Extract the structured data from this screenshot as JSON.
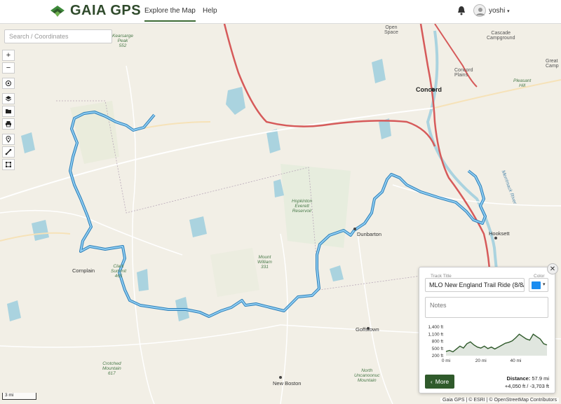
{
  "brand": {
    "name": "GAIA GPS"
  },
  "nav": {
    "explore": "Explore the Map",
    "help": "Help"
  },
  "user": {
    "name": "yoshi"
  },
  "search": {
    "placeholder": "Search / Coordinates"
  },
  "tools": [
    "zoom-in",
    "zoom-out",
    "locate",
    "layers",
    "folder",
    "print",
    "marker",
    "ruler",
    "area"
  ],
  "map_labels": {
    "concord": "Concord",
    "dunbarton": "Dunbarton",
    "goffstown": "Goffstown",
    "hooksett": "Hooksett",
    "new_boston": "New Boston",
    "cornplain": "Cornplain",
    "hopkinton": "Hopkinton\nEverett\nReservoir",
    "cascade": "Cascade\nCampground",
    "great": "Great\nCamp",
    "concord_plains": "Concord\nPlains",
    "pleasant_hill": "Pleasant\nHill",
    "clark_summit": "Clark\nSummit\n465",
    "mount_william": "Mount\nWilliam\n331",
    "crotched": "Crotched\nMountain\n617",
    "north_unc": "North\nUncanoonuc\nMountain",
    "peak_352": "Kearsarge\nPeak\n552",
    "open_space": "Open\nSpace",
    "river": "Merrimack River"
  },
  "panel": {
    "track_title_label": "Track Title",
    "track_title": "MLO New England Trail Ride (8/8/2",
    "color_label": "Color",
    "color": "#1a8cf0",
    "notes_placeholder": "Notes",
    "more_label": "More",
    "distance_label": "Distance:",
    "distance_value": "57.9 mi",
    "elevation": "+4,050 ft / -3,703 ft"
  },
  "chart_data": {
    "type": "area",
    "xlabel": "",
    "ylabel": "",
    "x_ticks": [
      "0 mi",
      "20 mi",
      "40 mi"
    ],
    "y_ticks": [
      "1,400 ft",
      "1,100 ft",
      "800 ft",
      "500 ft",
      "200 ft"
    ],
    "xlim": [
      0,
      57.9
    ],
    "ylim": [
      200,
      1400
    ],
    "x": [
      0,
      2,
      4,
      6,
      8,
      10,
      12,
      14,
      16,
      18,
      20,
      22,
      24,
      26,
      28,
      30,
      32,
      34,
      36,
      38,
      40,
      42,
      44,
      46,
      48,
      50,
      52,
      54,
      56,
      57.9
    ],
    "values": [
      380,
      420,
      360,
      480,
      600,
      520,
      700,
      780,
      650,
      560,
      520,
      600,
      500,
      560,
      480,
      560,
      640,
      720,
      760,
      820,
      950,
      1100,
      1000,
      900,
      850,
      1100,
      1000,
      900,
      700,
      650
    ],
    "line_color": "#2f5a2b"
  },
  "scale_label": "3 mi",
  "attribution": "Gaia GPS | © ESRI | © OpenStreetMap Contributors"
}
